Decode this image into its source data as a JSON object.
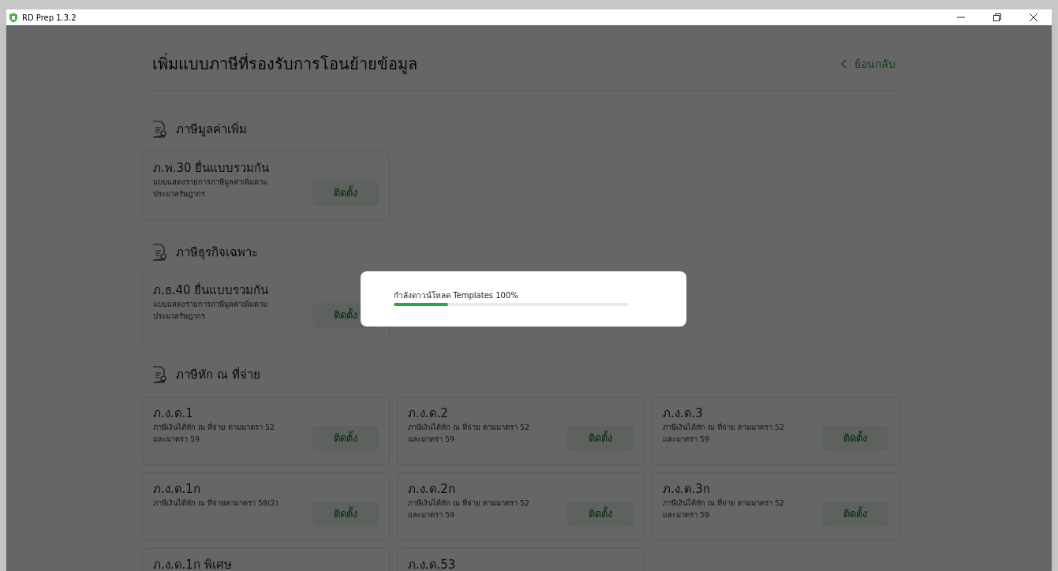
{
  "window": {
    "title": "RD Prep 1.3.2"
  },
  "page": {
    "title": "เพิ่มแบบภาษีที่รองรับการโอนย้ายข้อมูล",
    "back": "ย้อนกลับ"
  },
  "sections": [
    {
      "title": "ภาษีมูลค่าเพิ่ม",
      "forms": [
        {
          "title": "ภ.พ.30 ยื่นแบบรวมกัน",
          "description": [
            "แบบแสดงรายการภาษีมูลค่าเพิ่มตาม",
            "ประมวลรัษฎากร"
          ],
          "button": "ติดตั้ง"
        }
      ]
    },
    {
      "title": "ภาษีธุรกิจเฉพาะ",
      "forms": [
        {
          "title": "ภ.ธ.40 ยื่นแบบรวมกัน",
          "description": [
            "แบบแสดงรายการภาษีมูลค่าเพิ่มตาม",
            "ประมวลรัษฎากร"
          ],
          "button": "ติดตั้ง"
        }
      ]
    },
    {
      "title": "ภาษีหัก ณ ที่จ่าย",
      "forms": [
        {
          "title": "ภ.ง.ด.1",
          "description": [
            "ภาษีเงินได้หัก ณ ที่จ่าย ตามมาตรา 52",
            "และมาตรา 59"
          ],
          "button": "ติดตั้ง"
        },
        {
          "title": "ภ.ง.ด.2",
          "description": [
            "ภาษีเงินได้หัก ณ ที่จ่าย ตามมาตรา 52",
            "และมาตรา 59"
          ],
          "button": "ติดตั้ง"
        },
        {
          "title": "ภ.ง.ด.3",
          "description": [
            "ภาษีเงินได้หัก ณ ที่จ่าย ตามมาตรา 52",
            "และมาตรา 59"
          ],
          "button": "ติดตั้ง"
        },
        {
          "title": "ภ.ง.ด.1ก",
          "description": [
            "ภาษีเงินได้หัก ณ ที่จ่ายตามาตรา 58(2)"
          ],
          "button": "ติดตั้ง"
        },
        {
          "title": "ภ.ง.ด.2ก",
          "description": [
            "ภาษีเงินได้หัก ณ ที่จ่าย ตามมาตรา 52",
            "และมาตรา 59"
          ],
          "button": "ติดตั้ง"
        },
        {
          "title": "ภ.ง.ด.3ก",
          "description": [
            "ภาษีเงินได้หัก ณ ที่จ่าย ตามมาตรา 52",
            "และมาตรา 59"
          ],
          "button": "ติดตั้ง"
        },
        {
          "title": "ภ.ง.ด.1ก พิเศษ"
        },
        {
          "title": "ภ.ง.ด.53"
        }
      ]
    }
  ],
  "modal": {
    "text": "กำลังดาวน์โหลด Templates 100%",
    "level": 0.23
  }
}
